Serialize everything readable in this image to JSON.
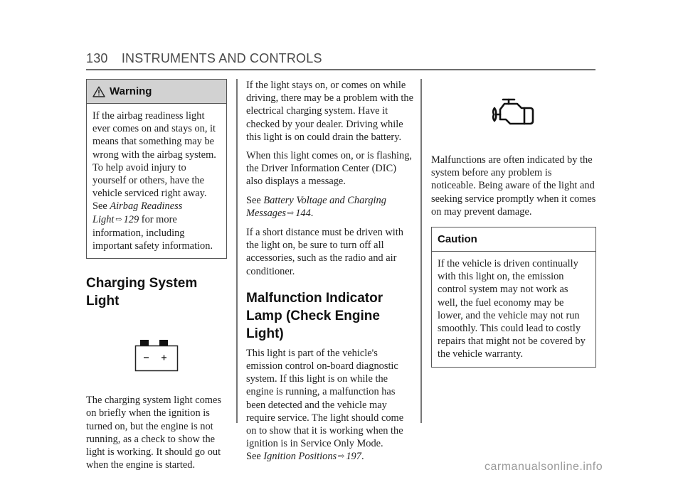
{
  "header": {
    "page_number": "130",
    "section_title": "INSTRUMENTS AND CONTROLS"
  },
  "column1": {
    "warning": {
      "icon": "warning-triangle-icon",
      "title": "Warning",
      "body_before_ref": "If the airbag readiness light ever comes on and stays on, it means that something may be wrong with the airbag system. To help avoid injury to yourself or others, have the vehicle serviced right away. See ",
      "ref_title": "Airbag Readiness Light",
      "ref_arrow": "⇨",
      "ref_page": "129",
      "body_after_ref": " for more information, including important safety information."
    },
    "heading": "Charging System Light",
    "battery_icon": {
      "name": "battery-icon",
      "minus": "−",
      "plus": "+"
    },
    "paragraph": "The charging system light comes on briefly when the ignition is turned on, but the engine is not running, as a check to show the light is working. It should go out when the engine is started."
  },
  "column2": {
    "p1": "If the light stays on, or comes on while driving, there may be a problem with the electrical charging system. Have it checked by your dealer. Driving while this light is on could drain the battery.",
    "p2": "When this light comes on, or is flashing, the Driver Information Center (DIC) also displays a message.",
    "p3": {
      "see": "See ",
      "ref_title": "Battery Voltage and Charging Messages",
      "ref_arrow": "⇨",
      "ref_page": "144",
      "end": "."
    },
    "p4": "If a short distance must be driven with the light on, be sure to turn off all accessories, such as the radio and air conditioner.",
    "heading": "Malfunction Indicator Lamp (Check Engine Light)",
    "p5": "This light is part of the vehicle's emission control on-board diagnostic system. If this light is on while the engine is running, a malfunction has been detected and the vehicle may require service. The light should come on to show that it is working when the ignition is in Service Only Mode.",
    "p6": {
      "see": "See ",
      "ref_title": "Ignition Positions",
      "ref_arrow": "⇨",
      "ref_page": "197",
      "end": "."
    }
  },
  "column3": {
    "engine_icon": "check-engine-icon",
    "paragraph": "Malfunctions are often indicated by the system before any problem is noticeable. Being aware of the light and seeking service promptly when it comes on may prevent damage.",
    "caution": {
      "title": "Caution",
      "body": "If the vehicle is driven continually with this light on, the emission control system may not work as well, the fuel economy may be lower, and the vehicle may not run smoothly. This could lead to costly repairs that might not be covered by the vehicle warranty."
    }
  },
  "watermark": "carmanualsonline.info"
}
